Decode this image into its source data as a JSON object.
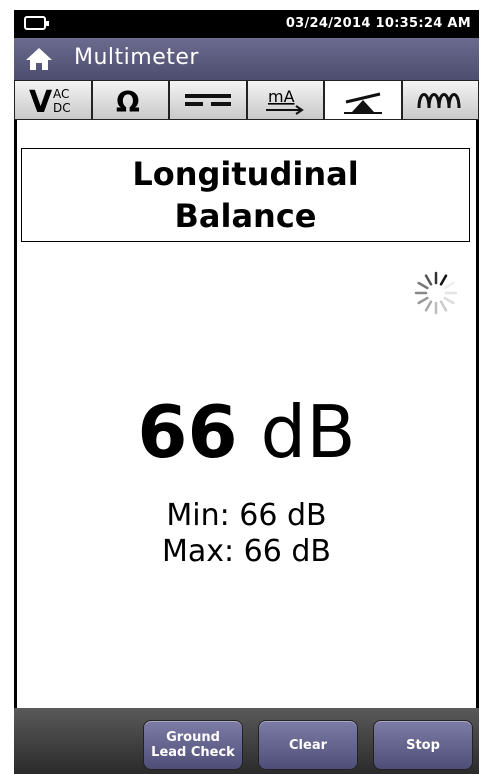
{
  "status": {
    "datetime": "03/24/2014 10:35:24 AM",
    "battery_icon": "battery-icon"
  },
  "titlebar": {
    "title": "Multimeter",
    "home_icon": "home-icon"
  },
  "tabs": [
    {
      "label": "V AC DC",
      "icon": "volts-ac-dc-icon"
    },
    {
      "label": "Ω",
      "icon": "ohm-icon"
    },
    {
      "label": "capacitance",
      "icon": "capacitance-icon"
    },
    {
      "label": "mA",
      "icon": "milliamp-icon"
    },
    {
      "label": "balance",
      "icon": "balance-icon",
      "active": true
    },
    {
      "label": "inductance",
      "icon": "coil-icon"
    }
  ],
  "measurement": {
    "heading_line1": "Longitudinal",
    "heading_line2": "Balance",
    "value": "66",
    "unit": "dB",
    "min_label": "Min: 66 dB",
    "max_label": "Max: 66 dB"
  },
  "buttons": {
    "ground_line1": "Ground",
    "ground_line2": "Lead Check",
    "clear": "Clear",
    "stop": "Stop"
  },
  "colors": {
    "title_bg": "#5c5c80",
    "button_bg": "#6a6a94"
  }
}
